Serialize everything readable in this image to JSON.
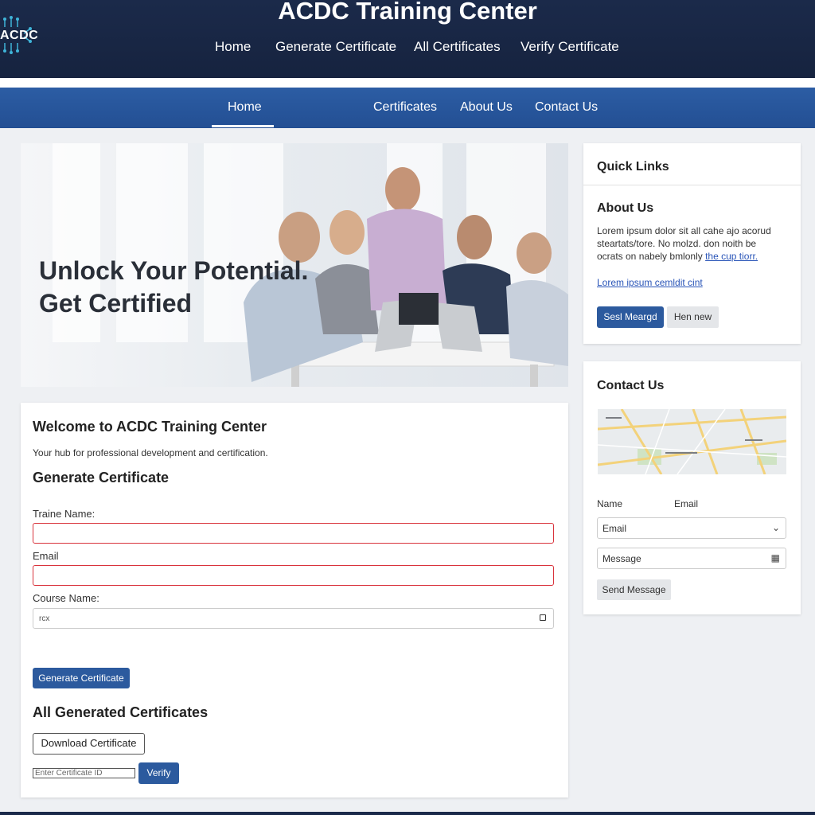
{
  "header": {
    "logo_text": "ACDC",
    "title": "ACDC Training Center",
    "nav": [
      "Home",
      "Generate Certificate",
      "All Certificates",
      "Verify Certificate"
    ]
  },
  "subnav": {
    "items": [
      "Home",
      "Certificates",
      "About Us",
      "Contact Us"
    ],
    "active": "Home"
  },
  "hero": {
    "line1": "Unlock Your Potential.",
    "line2": "Get Certified"
  },
  "main": {
    "welcome_title": "Welcome to ACDC Training Center",
    "welcome_text": "Your hub for professional development and certification.",
    "generate_title": "Generate Certificate",
    "trainee_label": "Traine Name:",
    "trainee_value": "",
    "email_label": "Email",
    "email_value": "",
    "course_label": "Course Name:",
    "course_value": "rcx",
    "generate_button": "Generate Certificate",
    "all_title": "All Generated Certificates",
    "download_button": "Download Certificate",
    "verify_placeholder": "Enter Certificate ID",
    "verify_button": "Verify"
  },
  "quick_links": {
    "title": "Quick Links",
    "about_title": "About Us",
    "about_text_1": "Lorem ipsum dolor sit all cahe ajo acorud",
    "about_text_2": "steartats/tore. No molzd. don noith be",
    "about_text_3": "ocrats on nabely bmlonly",
    "about_text_link": "the cup tiorr.",
    "link_text": "Lorem ipsum cemldit cint",
    "btn_primary": "Sesl Meargd",
    "btn_secondary": "Hen new"
  },
  "contact": {
    "title": "Contact Us",
    "name_label": "Name",
    "email_label": "Email",
    "email_placeholder": "Email",
    "message_placeholder": "Message",
    "send_button": "Send Message"
  },
  "colors": {
    "header_bg": "#1b2a4a",
    "nav_blue": "#2c5da4",
    "primary_button": "#2c5a9e",
    "error_border": "#d9333c"
  }
}
